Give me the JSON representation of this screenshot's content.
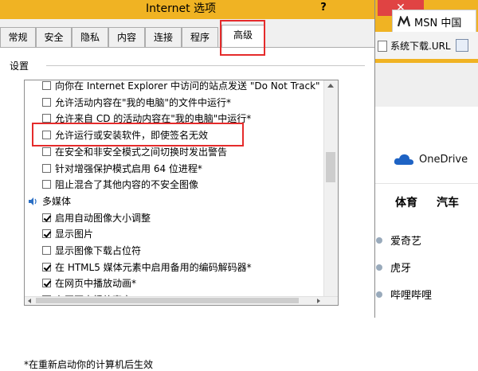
{
  "dialog": {
    "title": "Internet 选项",
    "help": "?",
    "tabs": [
      "常规",
      "安全",
      "隐私",
      "内容",
      "连接",
      "程序",
      "高级"
    ],
    "active_tab": "高级",
    "settings_label": "设置",
    "items": [
      {
        "label": "向你在 Internet Explorer 中访问的站点发送 \"Do Not Track\"",
        "checked": false
      },
      {
        "label": "允许活动内容在\"我的电脑\"的文件中运行*",
        "checked": false
      },
      {
        "label": "允许来自 CD 的活动内容在\"我的电脑\"中运行*",
        "checked": false
      },
      {
        "label": "允许运行或安装软件，即使签名无效",
        "checked": false
      },
      {
        "label": "在安全和非安全模式之间切换时发出警告",
        "checked": false
      },
      {
        "label": "针对增强保护模式启用 64 位进程*",
        "checked": false
      },
      {
        "label": "阻止混合了其他内容的不安全图像",
        "checked": false
      },
      {
        "label": "多媒体",
        "category": true
      },
      {
        "label": "启用自动图像大小调整",
        "checked": true
      },
      {
        "label": "显示图片",
        "checked": true
      },
      {
        "label": "显示图像下载占位符",
        "checked": false
      },
      {
        "label": "在 HTML5 媒体元素中启用备用的编码解码器*",
        "checked": true
      },
      {
        "label": "在网页中播放动画*",
        "checked": true
      },
      {
        "label": "在网页中播放声音",
        "checked": true
      }
    ],
    "footnote": "*在重新启动你的计算机后生效"
  },
  "browser": {
    "close_symbol": "✕",
    "tab_title": "MSN 中国",
    "favorite": "系统下载.URL",
    "onedrive": "OneDrive",
    "nav": [
      "体育",
      "汽车"
    ],
    "links": [
      "爱奇艺",
      "虎牙",
      "哔哩哔哩"
    ]
  },
  "colors": {
    "titlebar": "#f0b323",
    "highlight": "#e52b2b",
    "close": "#e04343"
  },
  "icons": [
    "msn-icon",
    "onedrive-cloud-icon",
    "multimedia-category-icon"
  ]
}
